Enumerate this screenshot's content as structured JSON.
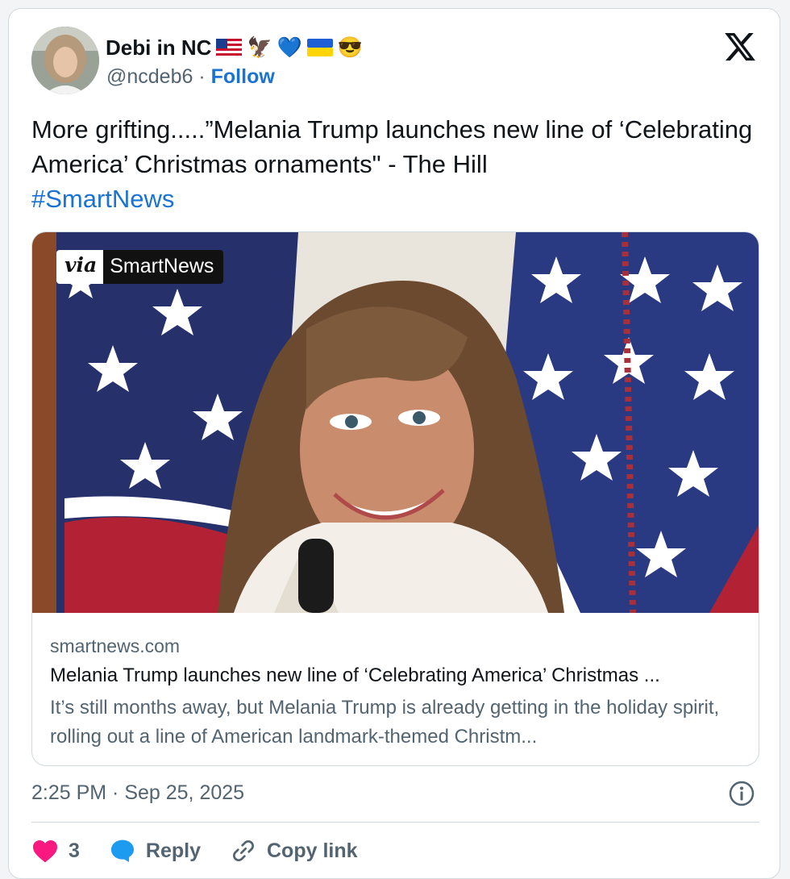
{
  "author": {
    "display_name": "Debi in NC",
    "name_emojis": [
      "🦅",
      "💙",
      "😎"
    ],
    "handle": "@ncdeb6",
    "separator": "·",
    "follow_label": "Follow"
  },
  "tweet": {
    "text": "More grifting.....”Melania Trump launches new line of ‘Celebrating America’ Christmas ornaments\" - The Hill",
    "hashtag": "#SmartNews"
  },
  "link_card": {
    "badge_via": "via",
    "badge_source": "SmartNews",
    "domain": "smartnews.com",
    "headline": "Melania Trump launches new line of ‘Celebrating America’ Christmas ...",
    "description": "It’s still months away, but Melania Trump is already getting in the holiday spirit, rolling out a line of American landmark-themed Christm..."
  },
  "meta": {
    "timestamp": "2:25 PM · Sep 25, 2025"
  },
  "actions": {
    "like_count": "3",
    "reply_label": "Reply",
    "copy_link_label": "Copy link"
  },
  "colors": {
    "link_blue": "#1a73d4",
    "heart_red": "#f91880",
    "secondary_text": "#536471"
  },
  "icons": [
    "x-logo-icon",
    "info-icon",
    "heart-icon",
    "reply-bubble-icon",
    "link-icon"
  ]
}
